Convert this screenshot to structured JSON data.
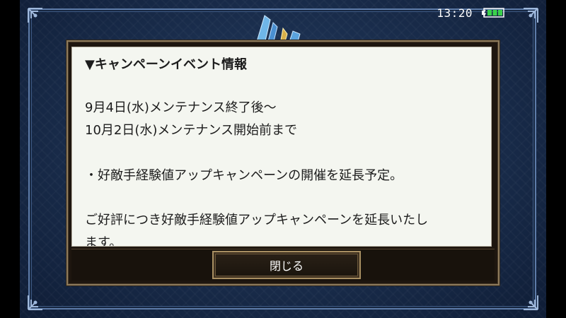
{
  "status": {
    "time": "13:20",
    "battery_icon": "battery-charging-icon",
    "battery_color": "#3ad14a"
  },
  "dialog": {
    "title": "▼キャンペーンイベント情報",
    "lines": [
      "9月4日(水)メンテナンス終了後～",
      "10月2日(水)メンテナンス開始前まで",
      "・好敵手経験値アップキャンペーンの開催を延長予定。",
      "ご好評につき好敵手経験値アップキャンペーンを延長いたし",
      "ます。"
    ],
    "close_label": "閉じる"
  },
  "icons": {
    "corner_ornament": "ornament-icon",
    "crystal": "crystal-emblem-icon"
  },
  "colors": {
    "dialog_frame": "#8c7a5c",
    "content_bg": "#f4f6f0",
    "background_blue": "#1b2f4f"
  }
}
